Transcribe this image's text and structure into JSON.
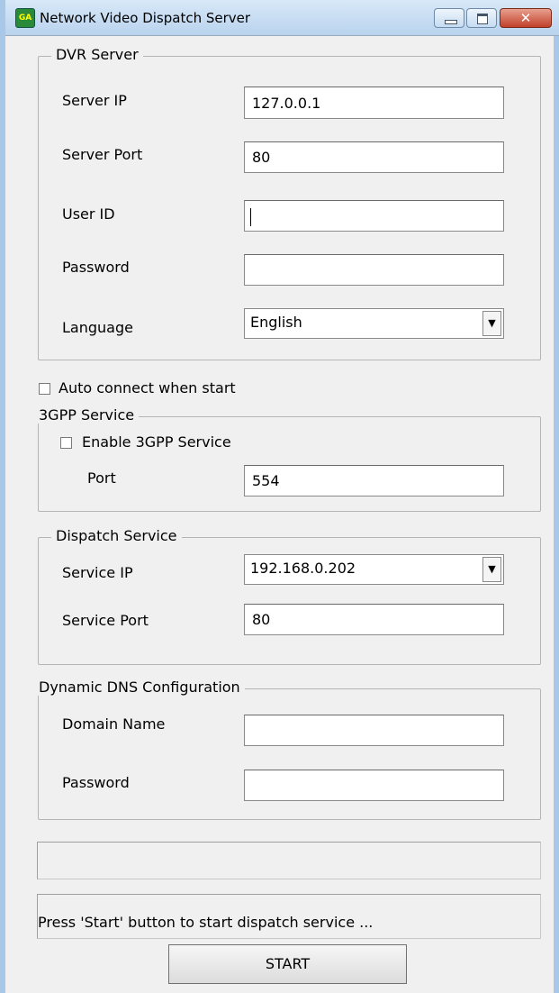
{
  "window": {
    "title": "Network Video Dispatch Server",
    "app_icon_text": "GA",
    "close_glyph": "✕"
  },
  "dvr_server": {
    "legend": "DVR Server",
    "server_ip_label": "Server IP",
    "server_ip_value": "127.0.0.1",
    "server_port_label": "Server Port",
    "server_port_value": "80",
    "user_id_label": "User ID",
    "user_id_value": "",
    "password_label": "Password",
    "password_value": "",
    "language_label": "Language",
    "language_value": "English"
  },
  "auto_connect": {
    "label": "Auto connect when start",
    "checked": false
  },
  "gpp_service": {
    "legend": "3GPP Service",
    "enable_label": "Enable 3GPP Service",
    "enable_checked": false,
    "port_label": "Port",
    "port_value": "554"
  },
  "dispatch_service": {
    "legend": "Dispatch Service",
    "service_ip_label": "Service IP",
    "service_ip_value": "192.168.0.202",
    "service_port_label": "Service Port",
    "service_port_value": "80"
  },
  "ddns": {
    "legend": "Dynamic DNS Configuration",
    "domain_label": "Domain Name",
    "domain_value": "",
    "password_label": "Password",
    "password_value": ""
  },
  "progress": {
    "value": 0
  },
  "status": {
    "text": "Press 'Start' button to start dispatch service ..."
  },
  "start_button": {
    "label": "START"
  },
  "icons": {
    "dropdown_arrow": "▼"
  }
}
